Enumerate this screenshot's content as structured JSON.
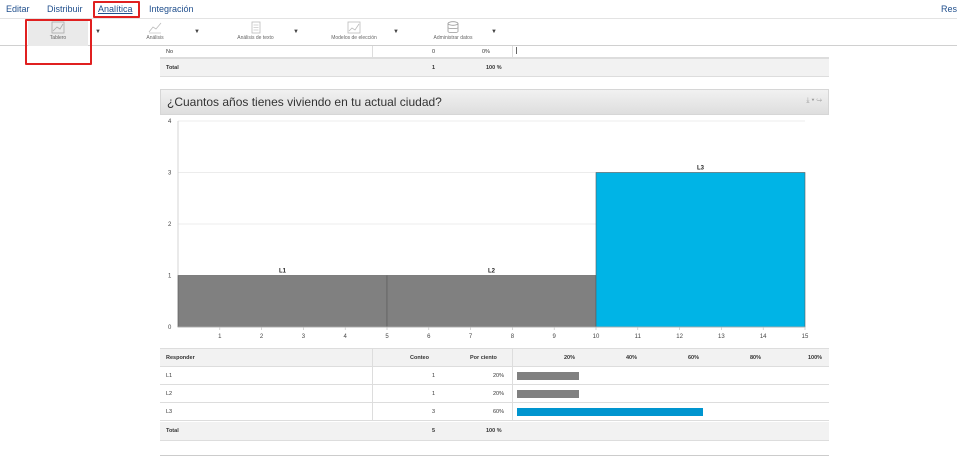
{
  "nav": {
    "items": [
      "Editar",
      "Distribuir",
      "Analítica",
      "Integración"
    ],
    "active_index": 2,
    "right_label": "Resp"
  },
  "toolbar": {
    "items": [
      {
        "label": "Tablero",
        "icon": "dashboard-icon",
        "selected": true
      },
      {
        "label": "Análisis",
        "icon": "analysis-icon",
        "selected": false
      },
      {
        "label": "Análisis de texto",
        "icon": "text-analysis-icon",
        "selected": false
      },
      {
        "label": "Modelos de elección",
        "icon": "choice-models-icon",
        "selected": false
      },
      {
        "label": "Administrar datos",
        "icon": "database-icon",
        "selected": false
      }
    ]
  },
  "previous_table": {
    "rows": [
      {
        "label": "No",
        "count": "0",
        "percent": "0%"
      }
    ],
    "total": {
      "label": "Total",
      "count": "1",
      "percent": "100 %"
    }
  },
  "question": {
    "title": "¿Cuantos años tienes viviendo en tu actual ciudad?"
  },
  "chart_data": {
    "type": "bar",
    "categories": [
      "L1",
      "L2",
      "L3"
    ],
    "bins": [
      [
        0,
        5
      ],
      [
        5,
        10
      ],
      [
        10,
        15
      ]
    ],
    "values": [
      1,
      1,
      3
    ],
    "colors": [
      "#808080",
      "#808080",
      "#00b4e6"
    ],
    "x_ticks": [
      "1",
      "2",
      "3",
      "4",
      "5",
      "6",
      "7",
      "8",
      "9",
      "10",
      "11",
      "12",
      "13",
      "14",
      "15"
    ],
    "y_ticks": [
      "0",
      "1",
      "2",
      "3",
      "4"
    ],
    "xlim": [
      0,
      15
    ],
    "ylim": [
      0,
      4
    ],
    "grid": true
  },
  "results_table": {
    "headers": {
      "responder": "Responder",
      "count": "Conteo",
      "percent": "Por ciento"
    },
    "scale": [
      "20%",
      "40%",
      "60%",
      "80%",
      "100%"
    ],
    "rows": [
      {
        "label": "L1",
        "count": "1",
        "percent": "20%",
        "value": 0.2,
        "color": "#808080"
      },
      {
        "label": "L2",
        "count": "1",
        "percent": "20%",
        "value": 0.2,
        "color": "#808080"
      },
      {
        "label": "L3",
        "count": "3",
        "percent": "60%",
        "value": 0.6,
        "color": "#0095cf"
      }
    ],
    "total": {
      "label": "Total",
      "count": "5",
      "percent": "100 %"
    }
  }
}
